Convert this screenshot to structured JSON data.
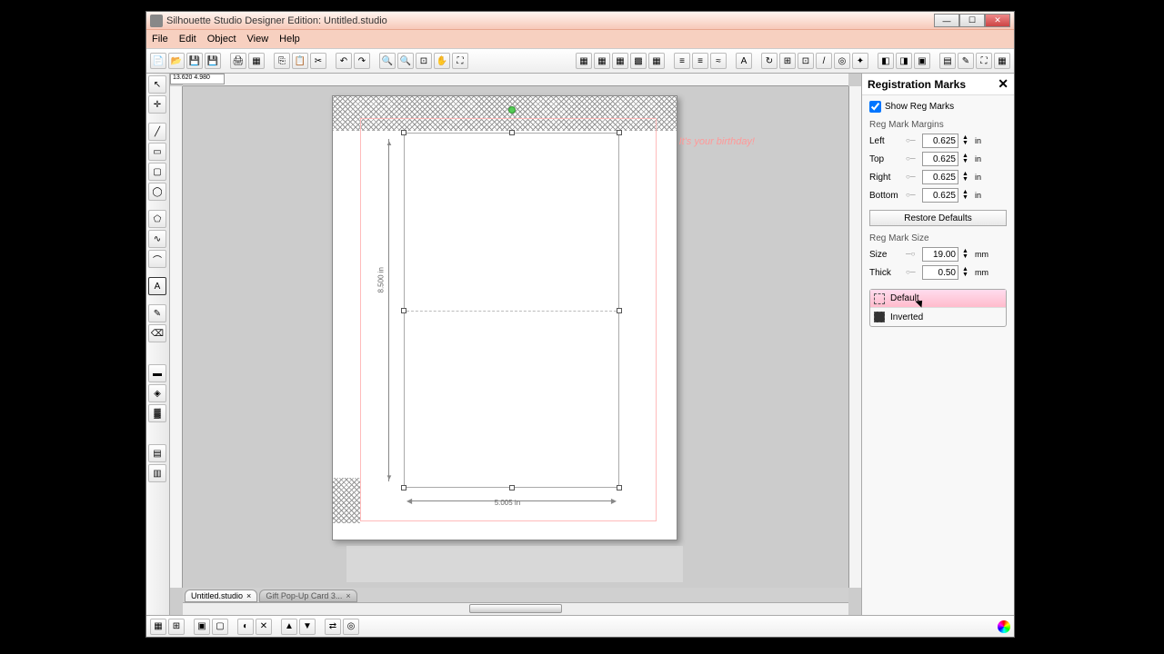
{
  "window": {
    "title": "Silhouette Studio Designer Edition: Untitled.studio"
  },
  "menu": {
    "file": "File",
    "edit": "Edit",
    "object": "Object",
    "view": "View",
    "help": "Help"
  },
  "coords": "13.620   4.980",
  "tabs": [
    {
      "label": "Untitled.studio",
      "active": true
    },
    {
      "label": "Gift Pop-Up Card 3...",
      "active": false
    }
  ],
  "canvas": {
    "width_label": "5.005 in",
    "height_label": "8.500 in",
    "watermark": "It's your birthday!"
  },
  "panel": {
    "title": "Registration Marks",
    "show_label": "Show Reg Marks",
    "show_checked": true,
    "margins_label": "Reg Mark Margins",
    "margins": {
      "left": {
        "label": "Left",
        "value": "0.625",
        "unit": "in"
      },
      "top": {
        "label": "Top",
        "value": "0.625",
        "unit": "in"
      },
      "right": {
        "label": "Right",
        "value": "0.625",
        "unit": "in"
      },
      "bottom": {
        "label": "Bottom",
        "value": "0.625",
        "unit": "in"
      }
    },
    "restore_label": "Restore Defaults",
    "size_label": "Reg Mark Size",
    "size": {
      "label": "Size",
      "value": "19.00",
      "unit": "mm"
    },
    "thick": {
      "label": "Thick",
      "value": "0.50",
      "unit": "mm"
    },
    "styles": {
      "default": "Default",
      "inverted": "Inverted"
    }
  }
}
